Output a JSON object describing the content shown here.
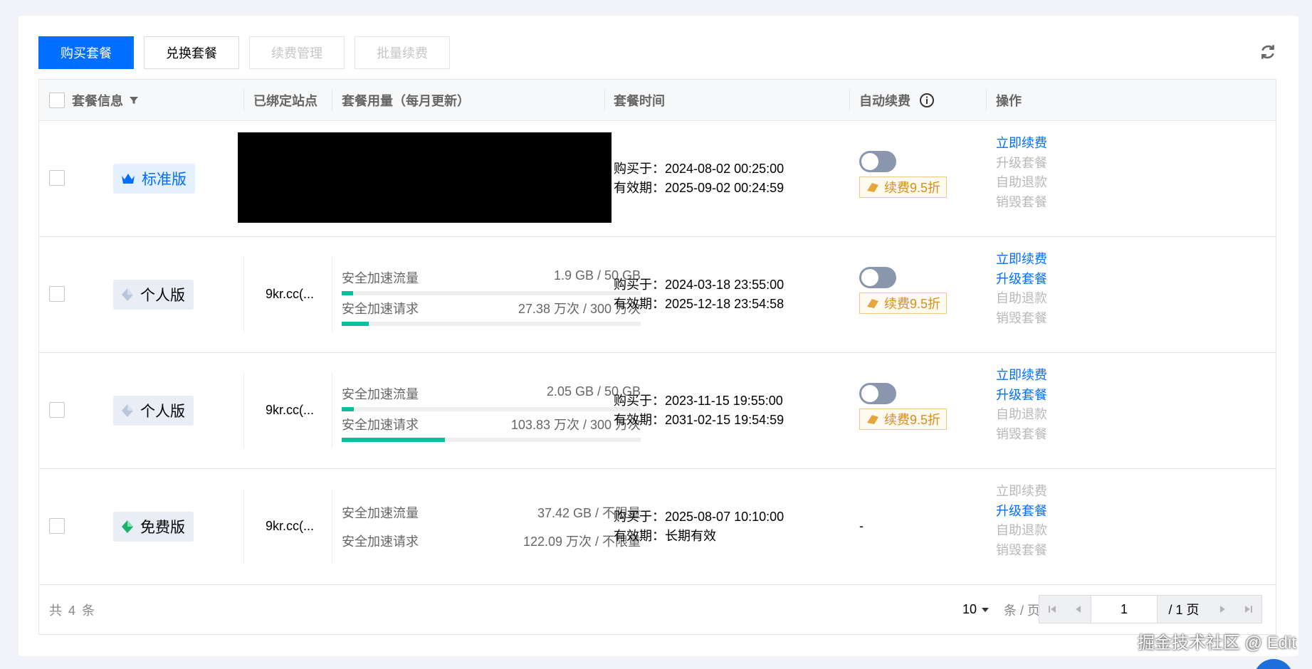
{
  "toolbar": {
    "buy": "购买套餐",
    "exchange": "兑换套餐",
    "renew_manage": "续费管理",
    "batch_renew": "批量续费"
  },
  "table": {
    "headers": {
      "info": "套餐信息",
      "site": "已绑定站点",
      "usage": "套餐用量（每月更新）",
      "time": "套餐时间",
      "auto_renew": "自动续费",
      "ops": "操作"
    },
    "rows": [
      {
        "plan": "标准版",
        "site": "",
        "site_redacted": true,
        "purchase": "购买于：2024-08-02 00:25:00",
        "expire": "有效期：2025-09-02 00:24:59",
        "auto_renew": "toggle",
        "discount": "续费9.5折",
        "ops": [
          "立即续费",
          "升级套餐",
          "自助退款",
          "销毁套餐"
        ]
      },
      {
        "plan": "个人版",
        "site": "9kr.cc(...",
        "traffic_label": "安全加速流量",
        "traffic_value": "1.9 GB / 50 GB",
        "traffic_pct": 3.8,
        "request_label": "安全加速请求",
        "request_value": "27.38 万次 / 300 万次",
        "request_pct": 9.1,
        "purchase": "购买于：2024-03-18 23:55:00",
        "expire": "有效期：2025-12-18 23:54:58",
        "discount": "续费9.5折",
        "ops": [
          "立即续费",
          "升级套餐",
          "自助退款",
          "销毁套餐"
        ]
      },
      {
        "plan": "个人版",
        "site": "9kr.cc(...",
        "traffic_label": "安全加速流量",
        "traffic_value": "2.05 GB / 50 GB",
        "traffic_pct": 4.1,
        "request_label": "安全加速请求",
        "request_value": "103.83 万次 / 300 万次",
        "request_pct": 34.6,
        "purchase": "购买于：2023-11-15 19:55:00",
        "expire": "有效期：2031-02-15 19:54:59",
        "discount": "续费9.5折",
        "ops": [
          "立即续费",
          "升级套餐",
          "自助退款",
          "销毁套餐"
        ]
      },
      {
        "plan": "免费版",
        "site": "9kr.cc(...",
        "traffic_label": "安全加速流量",
        "traffic_value": "37.42 GB / 不限量",
        "request_label": "安全加速请求",
        "request_value": "122.09 万次 / 不限量",
        "purchase": "购买于：2025-08-07 10:10:00",
        "expire": "有效期：长期有效",
        "auto_renew_text": "-",
        "ops": [
          "立即续费",
          "升级套餐",
          "自助退款",
          "销毁套餐"
        ]
      }
    ]
  },
  "footer": {
    "total": "共 4 条",
    "page_size": "10",
    "page_size_unit": "条 / 页",
    "current_page": "1",
    "total_pages": "/ 1 页"
  },
  "watermark": "掘金技术社区 @ Edit",
  "colors": {
    "primary": "#006eff",
    "progress": "#0abf9f",
    "discount": "#d68e1a"
  }
}
